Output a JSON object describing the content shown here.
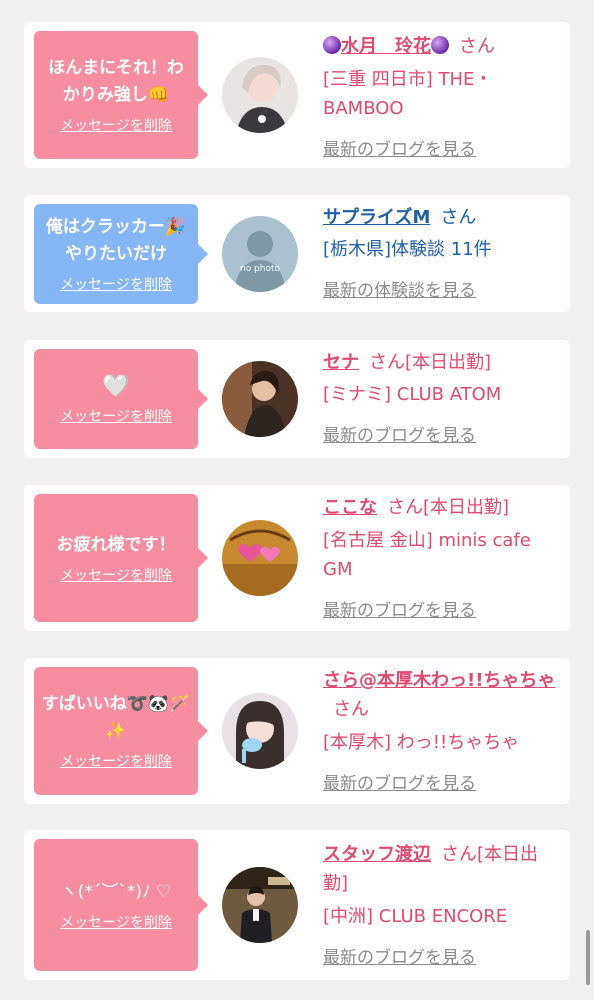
{
  "delete_label": "メッセージを削除",
  "messages": [
    {
      "bubble_color": "#f78da0",
      "message": "ほんまにそれ！わかりみ強し👊",
      "name": "水月　玲花",
      "has_orbs": true,
      "san": "さん",
      "status": "",
      "shop": "[三重 四日市] THE・BAMBOO",
      "link": "最新のブログを見る",
      "avatar_icon": "woman-photo-icon"
    },
    {
      "bubble_color": "#86b6f6",
      "message": "俺はクラッカー🎉やりたいだけ",
      "name": "サプライズM",
      "has_orbs": false,
      "san": "さん",
      "status": "",
      "shop": "[栃木県]体験談 11件",
      "link": "最新の体験談を見る",
      "avatar_icon": "no-photo-icon",
      "avatar_text": "no photo"
    },
    {
      "bubble_color": "#f78da0",
      "message": "🤍",
      "name": "セナ",
      "has_orbs": false,
      "san": "さん",
      "status": "[本日出勤]",
      "shop": "[ミナミ] CLUB ATOM",
      "link": "最新のブログを見る",
      "avatar_icon": "woman-photo-icon"
    },
    {
      "bubble_color": "#f78da0",
      "message": "お疲れ様です！",
      "name": "ここな",
      "has_orbs": false,
      "san": "さん",
      "status": "[本日出勤]",
      "shop": "[名古屋 金山] minis cafe GM",
      "link": "最新のブログを見る",
      "avatar_icon": "hearts-photo-icon"
    },
    {
      "bubble_color": "#f78da0",
      "message": "すばいいね➰🐼🪄✨",
      "name": "さら@本厚木わっ!!ちゃちゃ",
      "has_orbs": false,
      "san": "さん",
      "status": "",
      "shop": "[本厚木] わっ!!ちゃちゃ",
      "link": "最新のブログを見る",
      "avatar_icon": "woman-photo-icon"
    },
    {
      "bubble_color": "#f78da0",
      "message": "ヽ(*´︶`*)ﾉ ♡",
      "name": "スタッフ渡辺",
      "has_orbs": false,
      "san": "さん",
      "status": "[本日出勤]",
      "shop": "[中洲] CLUB ENCORE",
      "link": "最新のブログを見る",
      "avatar_icon": "staff-photo-icon"
    }
  ]
}
